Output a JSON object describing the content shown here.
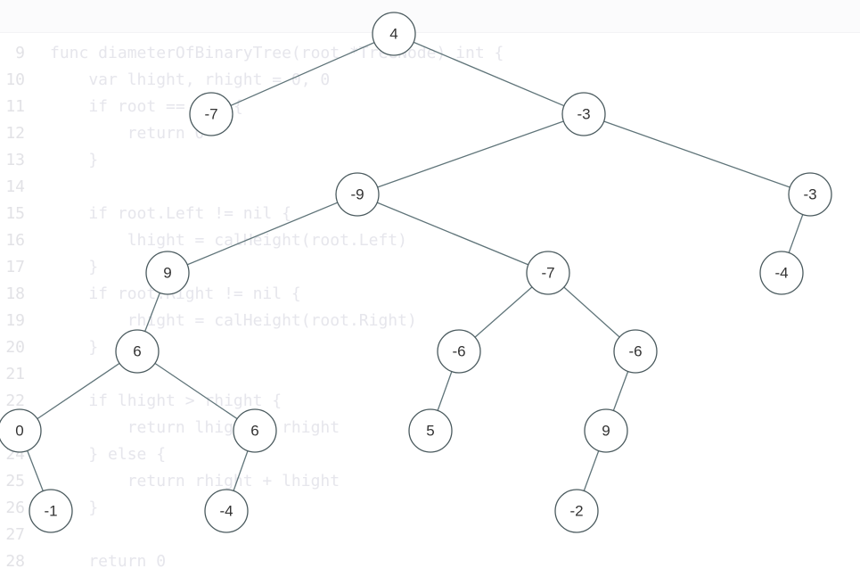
{
  "code": {
    "lines": [
      {
        "num": "9",
        "text": "func diameterOfBinaryTree(root *TreeNode) int {"
      },
      {
        "num": "10",
        "text": "    var lhight, rhight = 0, 0"
      },
      {
        "num": "11",
        "text": "    if root == nil {"
      },
      {
        "num": "12",
        "text": "        return 0"
      },
      {
        "num": "13",
        "text": "    }"
      },
      {
        "num": "14",
        "text": ""
      },
      {
        "num": "15",
        "text": "    if root.Left != nil {"
      },
      {
        "num": "16",
        "text": "        lhight = calHeight(root.Left)"
      },
      {
        "num": "17",
        "text": "    }"
      },
      {
        "num": "18",
        "text": "    if root.Right != nil {"
      },
      {
        "num": "19",
        "text": "        rhight = calHeight(root.Right)"
      },
      {
        "num": "20",
        "text": "    }"
      },
      {
        "num": "21",
        "text": ""
      },
      {
        "num": "22",
        "text": "    if lhight > rhight {"
      },
      {
        "num": "23",
        "text": "        return lhight + rhight"
      },
      {
        "num": "24",
        "text": "    } else {"
      },
      {
        "num": "25",
        "text": "        return rhight + lhight"
      },
      {
        "num": "26",
        "text": "    }"
      },
      {
        "num": "27",
        "text": ""
      },
      {
        "num": "28",
        "text": "    return 0"
      }
    ]
  },
  "tree": {
    "nodes": [
      {
        "id": "n0",
        "value": "4",
        "parent": null
      },
      {
        "id": "n1",
        "value": "-7",
        "parent": "n0"
      },
      {
        "id": "n2",
        "value": "-3",
        "parent": "n0"
      },
      {
        "id": "n3",
        "value": "-9",
        "parent": "n2"
      },
      {
        "id": "n4",
        "value": "-3",
        "parent": "n2"
      },
      {
        "id": "n5",
        "value": "9",
        "parent": "n3"
      },
      {
        "id": "n6",
        "value": "-7",
        "parent": "n3"
      },
      {
        "id": "n7",
        "value": "-4",
        "parent": "n4"
      },
      {
        "id": "n8",
        "value": "6",
        "parent": "n5"
      },
      {
        "id": "n9",
        "value": "-6",
        "parent": "n6"
      },
      {
        "id": "n10",
        "value": "-6",
        "parent": "n6"
      },
      {
        "id": "n11",
        "value": "0",
        "parent": "n8"
      },
      {
        "id": "n12",
        "value": "6",
        "parent": "n8"
      },
      {
        "id": "n13",
        "value": "5",
        "parent": "n9"
      },
      {
        "id": "n14",
        "value": "9",
        "parent": "n10"
      },
      {
        "id": "n15",
        "value": "-1",
        "parent": "n11"
      },
      {
        "id": "n16",
        "value": "-4",
        "parent": "n12"
      },
      {
        "id": "n17",
        "value": "-2",
        "parent": "n14"
      }
    ]
  }
}
